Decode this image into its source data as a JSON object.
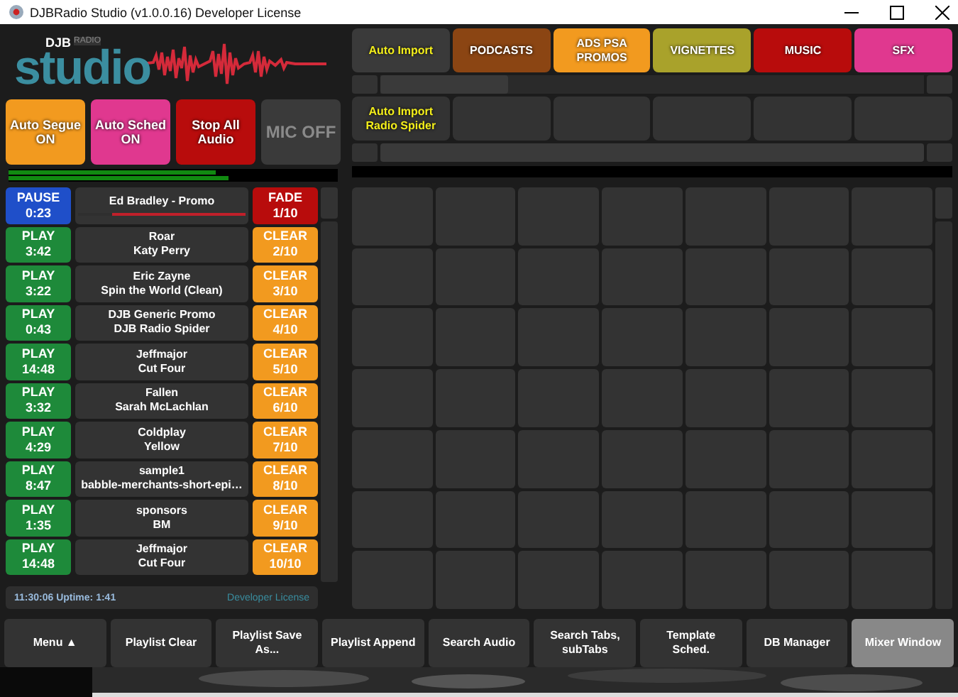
{
  "window": {
    "title": "DJBRadio Studio (v1.0.0.16) Developer License"
  },
  "logo": {
    "brand": "DJB",
    "tag": "RADIO",
    "word": "studio"
  },
  "controls": [
    {
      "lines": [
        "Auto Segue",
        "ON"
      ],
      "color": "#f29a1f",
      "kind": "toggle"
    },
    {
      "lines": [
        "Auto Sched",
        "ON"
      ],
      "color": "#e0388f",
      "kind": "toggle"
    },
    {
      "lines": [
        "Stop All",
        "Audio"
      ],
      "color": "#b80c0c",
      "kind": "toggle"
    },
    {
      "lines": [
        "MIC OFF"
      ],
      "color": "#3a3a3a",
      "kind": "mic"
    }
  ],
  "meters": [
    {
      "level": 0.63
    },
    {
      "level": 0.67
    }
  ],
  "playlist": [
    {
      "status": "PAUSE",
      "time": "0:23",
      "kind": "pause",
      "lines": [
        "Ed Bradley -  Promo"
      ],
      "progress": {
        "level": 0.8
      },
      "action": "FADE",
      "slot": "1/10"
    },
    {
      "status": "PLAY",
      "time": "3:42",
      "kind": "play",
      "lines": [
        "Roar",
        "Katy Perry"
      ],
      "action": "CLEAR",
      "slot": "2/10"
    },
    {
      "status": "PLAY",
      "time": "3:22",
      "kind": "play",
      "lines": [
        "Eric Zayne",
        "Spin the World  (Clean)"
      ],
      "action": "CLEAR",
      "slot": "3/10"
    },
    {
      "status": "PLAY",
      "time": "0:43",
      "kind": "play",
      "lines": [
        "DJB Generic Promo",
        "DJB Radio Spider"
      ],
      "action": "CLEAR",
      "slot": "4/10"
    },
    {
      "status": "PLAY",
      "time": "14:48",
      "kind": "play",
      "lines": [
        "Jeffmajor",
        "Cut Four"
      ],
      "action": "CLEAR",
      "slot": "5/10"
    },
    {
      "status": "PLAY",
      "time": "3:32",
      "kind": "play",
      "lines": [
        "Fallen",
        "Sarah McLachlan"
      ],
      "action": "CLEAR",
      "slot": "6/10"
    },
    {
      "status": "PLAY",
      "time": "4:29",
      "kind": "play",
      "lines": [
        "Coldplay",
        "Yellow"
      ],
      "action": "CLEAR",
      "slot": "7/10"
    },
    {
      "status": "PLAY",
      "time": "8:47",
      "kind": "play",
      "lines": [
        "sample1",
        "babble-merchants-short-epi…"
      ],
      "action": "CLEAR",
      "slot": "8/10"
    },
    {
      "status": "PLAY",
      "time": "1:35",
      "kind": "play",
      "lines": [
        "sponsors",
        "BM"
      ],
      "action": "CLEAR",
      "slot": "9/10"
    },
    {
      "status": "PLAY",
      "time": "14:48",
      "kind": "play",
      "lines": [
        "Jeffmajor",
        "Cut Four"
      ],
      "action": "CLEAR",
      "slot": "10/10"
    }
  ],
  "status_bar": {
    "clock": "11:30:06 Uptime: 1:41",
    "license": "Developer License"
  },
  "tabs": [
    {
      "lines": [
        "Auto Import"
      ],
      "kind": "import",
      "color": "#3a3a3a"
    },
    {
      "lines": [
        "PODCASTS"
      ],
      "kind": "category",
      "color": "#8b4513"
    },
    {
      "lines": [
        "ADS PSA",
        "PROMOS"
      ],
      "kind": "category",
      "color": "#f29a1f"
    },
    {
      "lines": [
        "VIGNETTES"
      ],
      "kind": "category",
      "color": "#a9a22b"
    },
    {
      "lines": [
        "MUSIC"
      ],
      "kind": "category",
      "color": "#b80c0c"
    },
    {
      "lines": [
        "SFX"
      ],
      "kind": "category",
      "color": "#e0388f"
    }
  ],
  "subtabs": [
    {
      "lines": [
        "Auto Import",
        "Radio Spider"
      ],
      "kind": "import"
    }
  ],
  "toolbar": [
    {
      "lines": [
        "Menu ▲"
      ],
      "selected": false
    },
    {
      "lines": [
        "Playlist Clear"
      ],
      "selected": false
    },
    {
      "lines": [
        "Playlist Save",
        "As..."
      ],
      "selected": false
    },
    {
      "lines": [
        "Playlist Append"
      ],
      "selected": false
    },
    {
      "lines": [
        "Search Audio"
      ],
      "selected": false
    },
    {
      "lines": [
        "Search Tabs,",
        "subTabs"
      ],
      "selected": false
    },
    {
      "lines": [
        "Template",
        "Sched."
      ],
      "selected": false
    },
    {
      "lines": [
        "DB Manager"
      ],
      "selected": false
    },
    {
      "lines": [
        "Mixer Window"
      ],
      "selected": true
    }
  ]
}
